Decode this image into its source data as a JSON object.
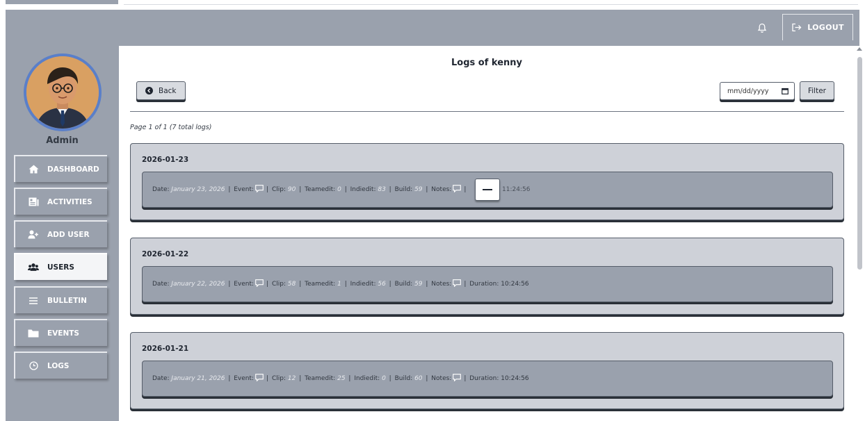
{
  "header": {
    "logout_label": "LOGOUT"
  },
  "sidebar": {
    "user_name": "Admin",
    "items": [
      {
        "label": "DASHBOARD",
        "icon": "home-icon"
      },
      {
        "label": "ACTIVITIES",
        "icon": "newspaper-icon"
      },
      {
        "label": "ADD USER",
        "icon": "user-plus-icon"
      },
      {
        "label": "USERS",
        "icon": "users-icon",
        "active": true
      },
      {
        "label": "BULLETIN",
        "icon": "menu-icon"
      },
      {
        "label": "EVENTS",
        "icon": "folder-icon"
      },
      {
        "label": "LOGS",
        "icon": "clock-icon"
      }
    ]
  },
  "main": {
    "title": "Logs of kenny",
    "back_label": "Back",
    "date_placeholder": "mm/dd/yyyy",
    "filter_label": "Filter",
    "page_info": "Page 1 of 1 (7 total logs)",
    "logs": [
      {
        "group_date": "2026-01-23",
        "date_label": "Date:",
        "date": "January 23, 2026",
        "event_label": "Event:",
        "clip_label": "Clip:",
        "clip": "90",
        "teamedit_label": "Teamedit:",
        "teamedit": "0",
        "indiedit_label": "Indiedit:",
        "indiedit": "83",
        "build_label": "Build:",
        "build": "59",
        "notes_label": "Notes:",
        "duration_label": "n:",
        "duration": "11:24:56"
      },
      {
        "group_date": "2026-01-22",
        "date_label": "Date:",
        "date": "January 22, 2026",
        "event_label": "Event:",
        "clip_label": "Clip:",
        "clip": "58",
        "teamedit_label": "Teamedit:",
        "teamedit": "1",
        "indiedit_label": "Indiedit:",
        "indiedit": "56",
        "build_label": "Build:",
        "build": "59",
        "notes_label": "Notes:",
        "duration_label": "Duration:",
        "duration": "10:24:56"
      },
      {
        "group_date": "2026-01-21",
        "date_label": "Date:",
        "date": "January 21, 2026",
        "event_label": "Event:",
        "clip_label": "Clip:",
        "clip": "12",
        "teamedit_label": "Teamedit:",
        "teamedit": "25",
        "indiedit_label": "Indiedit:",
        "indiedit": "0",
        "build_label": "Build:",
        "build": "60",
        "notes_label": "Notes:",
        "duration_label": "Duration:",
        "duration": "10:24:56"
      }
    ]
  },
  "colors": {
    "chrome": "#9aa1ad",
    "card": "#ced1d8",
    "entry": "#9aa1ad",
    "accent_ring": "#5a7fc9"
  }
}
